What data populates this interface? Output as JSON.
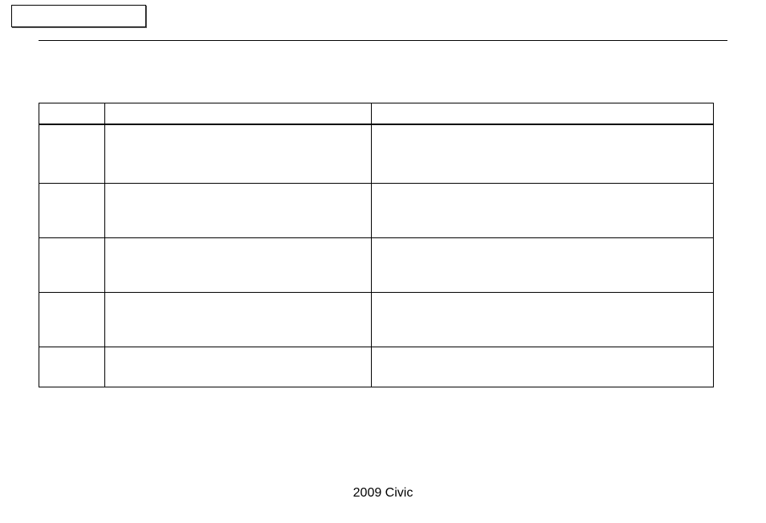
{
  "topbox": {
    "label": ""
  },
  "table": {
    "headers": [
      "",
      "",
      ""
    ],
    "rows": [
      [
        "",
        "",
        ""
      ],
      [
        "",
        "",
        ""
      ],
      [
        "",
        "",
        ""
      ],
      [
        "",
        "",
        ""
      ],
      [
        "",
        "",
        ""
      ]
    ]
  },
  "footer": {
    "text": "2009  Civic"
  }
}
